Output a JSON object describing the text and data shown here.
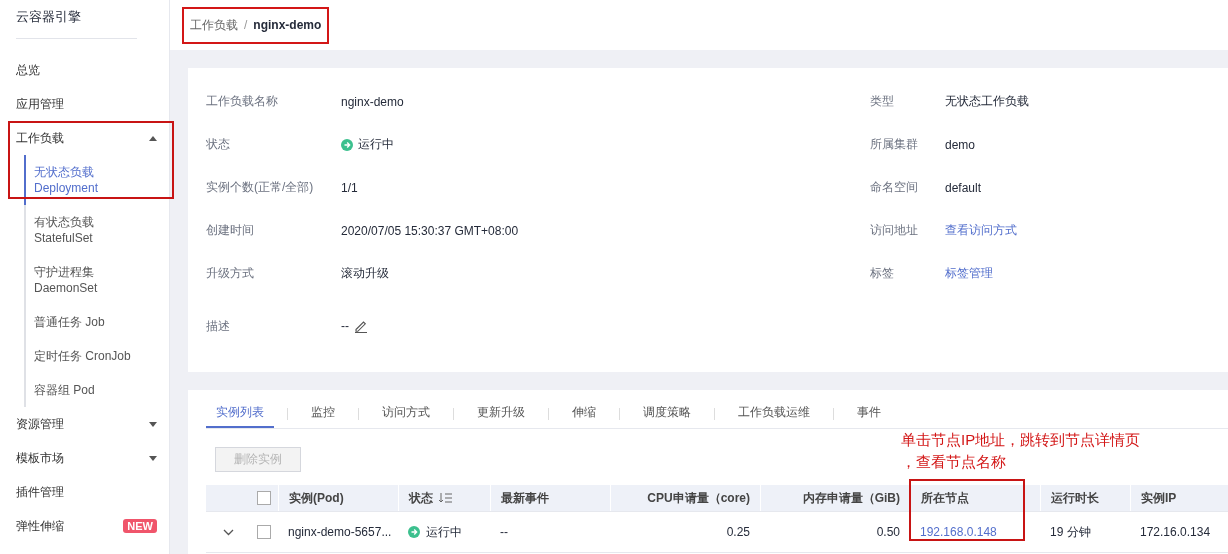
{
  "sidebar": {
    "title": "云容器引擎",
    "items": [
      {
        "kind": "item",
        "label": "总览"
      },
      {
        "kind": "item",
        "label": "应用管理"
      },
      {
        "kind": "group",
        "label": "工作负载",
        "expanded": true,
        "highlighted": true,
        "children": [
          {
            "label": "无状态负载",
            "sublabel": "Deployment",
            "selected": true
          },
          {
            "label": "有状态负载",
            "sublabel": "StatefulSet",
            "selected": false
          },
          {
            "label": "守护进程集",
            "sublabel": "DaemonSet",
            "selected": false
          },
          {
            "label": "普通任务 Job",
            "selected": false
          },
          {
            "label": "定时任务 CronJob",
            "selected": false
          },
          {
            "label": "容器组 Pod",
            "selected": false
          }
        ]
      },
      {
        "kind": "group",
        "label": "资源管理",
        "expanded": false
      },
      {
        "kind": "group",
        "label": "模板市场",
        "expanded": false
      },
      {
        "kind": "item",
        "label": "插件管理"
      },
      {
        "kind": "item",
        "label": "弹性伸缩",
        "badge": "NEW"
      }
    ]
  },
  "breadcrumb": {
    "parent": "工作负载",
    "separator": "/",
    "current": "nginx-demo",
    "highlighted": true
  },
  "details": {
    "left": [
      {
        "label": "工作负载名称",
        "value": "nginx-demo",
        "kind": "text"
      },
      {
        "label": "状态",
        "value": "运行中",
        "kind": "status"
      },
      {
        "label": "实例个数(正常/全部)",
        "value": "1/1",
        "kind": "text"
      },
      {
        "label": "创建时间",
        "value": "2020/07/05 15:30:37 GMT+08:00",
        "kind": "text"
      },
      {
        "label": "升级方式",
        "value": "滚动升级",
        "kind": "text"
      },
      {
        "label": "描述",
        "value": "--",
        "kind": "editable"
      }
    ],
    "right": [
      {
        "label": "类型",
        "value": "无状态工作负载",
        "kind": "text"
      },
      {
        "label": "所属集群",
        "value": "demo",
        "kind": "text"
      },
      {
        "label": "命名空间",
        "value": "default",
        "kind": "text"
      },
      {
        "label": "访问地址",
        "value": "查看访问方式",
        "kind": "link"
      },
      {
        "label": "标签",
        "value": "标签管理",
        "kind": "link"
      }
    ]
  },
  "tabs": [
    {
      "label": "实例列表",
      "selected": true
    },
    {
      "label": "监控",
      "selected": false
    },
    {
      "label": "访问方式",
      "selected": false
    },
    {
      "label": "更新升级",
      "selected": false
    },
    {
      "label": "伸缩",
      "selected": false
    },
    {
      "label": "调度策略",
      "selected": false
    },
    {
      "label": "工作负载运维",
      "selected": false
    },
    {
      "label": "事件",
      "selected": false
    }
  ],
  "delete_button": {
    "label": "删除实例",
    "disabled": true
  },
  "annotation": {
    "lines": [
      "单击节点IP地址，跳转到节点详情页",
      "，查看节点名称"
    ]
  },
  "table": {
    "select_all": {
      "checked": false
    },
    "columns": [
      {
        "label": "实例(Pod)",
        "kind": "text"
      },
      {
        "label": "状态",
        "kind": "text",
        "sortable": true
      },
      {
        "label": "最新事件",
        "kind": "text"
      },
      {
        "label": "CPU申请量（core)",
        "kind": "number"
      },
      {
        "label": "内存申请量（GiB)",
        "kind": "number"
      },
      {
        "label": "所在节点",
        "kind": "text",
        "highlighted": true
      },
      {
        "label": "运行时长",
        "kind": "text"
      },
      {
        "label": "实例IP",
        "kind": "text"
      }
    ],
    "rows": [
      {
        "expanded": false,
        "checked": false,
        "cells": [
          {
            "kind": "text",
            "text": "nginx-demo-5657..."
          },
          {
            "kind": "status",
            "text": "运行中"
          },
          {
            "kind": "text",
            "text": "--"
          },
          {
            "kind": "text",
            "text": "0.25"
          },
          {
            "kind": "text",
            "text": "0.50"
          },
          {
            "kind": "link",
            "text": "192.168.0.148"
          },
          {
            "kind": "text",
            "text": "19 分钟"
          },
          {
            "kind": "text",
            "text": "172.16.0.134"
          }
        ]
      }
    ]
  }
}
